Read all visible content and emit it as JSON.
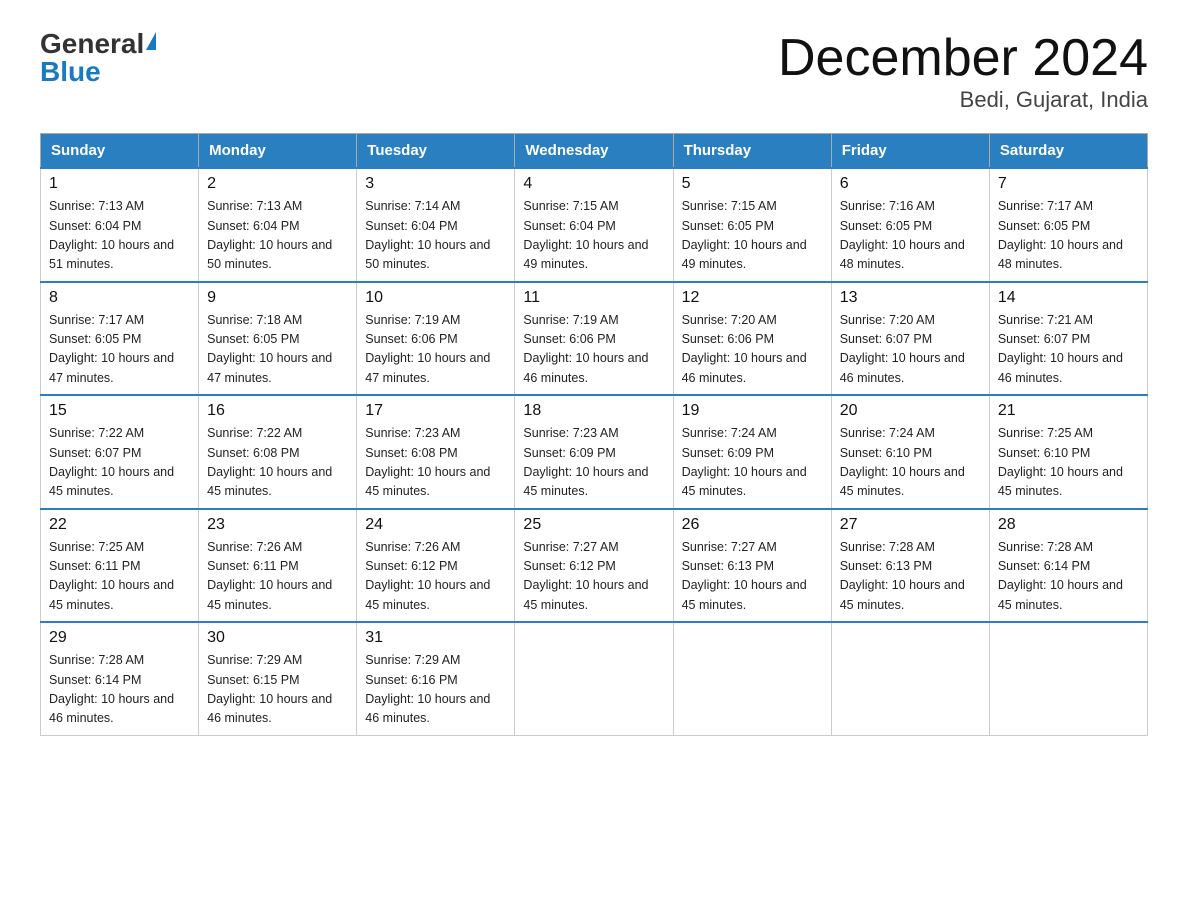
{
  "logo": {
    "general": "General",
    "blue": "Blue"
  },
  "title": {
    "month_year": "December 2024",
    "location": "Bedi, Gujarat, India"
  },
  "header_days": [
    "Sunday",
    "Monday",
    "Tuesday",
    "Wednesday",
    "Thursday",
    "Friday",
    "Saturday"
  ],
  "weeks": [
    [
      {
        "day": "1",
        "sunrise": "7:13 AM",
        "sunset": "6:04 PM",
        "daylight": "10 hours and 51 minutes."
      },
      {
        "day": "2",
        "sunrise": "7:13 AM",
        "sunset": "6:04 PM",
        "daylight": "10 hours and 50 minutes."
      },
      {
        "day": "3",
        "sunrise": "7:14 AM",
        "sunset": "6:04 PM",
        "daylight": "10 hours and 50 minutes."
      },
      {
        "day": "4",
        "sunrise": "7:15 AM",
        "sunset": "6:04 PM",
        "daylight": "10 hours and 49 minutes."
      },
      {
        "day": "5",
        "sunrise": "7:15 AM",
        "sunset": "6:05 PM",
        "daylight": "10 hours and 49 minutes."
      },
      {
        "day": "6",
        "sunrise": "7:16 AM",
        "sunset": "6:05 PM",
        "daylight": "10 hours and 48 minutes."
      },
      {
        "day": "7",
        "sunrise": "7:17 AM",
        "sunset": "6:05 PM",
        "daylight": "10 hours and 48 minutes."
      }
    ],
    [
      {
        "day": "8",
        "sunrise": "7:17 AM",
        "sunset": "6:05 PM",
        "daylight": "10 hours and 47 minutes."
      },
      {
        "day": "9",
        "sunrise": "7:18 AM",
        "sunset": "6:05 PM",
        "daylight": "10 hours and 47 minutes."
      },
      {
        "day": "10",
        "sunrise": "7:19 AM",
        "sunset": "6:06 PM",
        "daylight": "10 hours and 47 minutes."
      },
      {
        "day": "11",
        "sunrise": "7:19 AM",
        "sunset": "6:06 PM",
        "daylight": "10 hours and 46 minutes."
      },
      {
        "day": "12",
        "sunrise": "7:20 AM",
        "sunset": "6:06 PM",
        "daylight": "10 hours and 46 minutes."
      },
      {
        "day": "13",
        "sunrise": "7:20 AM",
        "sunset": "6:07 PM",
        "daylight": "10 hours and 46 minutes."
      },
      {
        "day": "14",
        "sunrise": "7:21 AM",
        "sunset": "6:07 PM",
        "daylight": "10 hours and 46 minutes."
      }
    ],
    [
      {
        "day": "15",
        "sunrise": "7:22 AM",
        "sunset": "6:07 PM",
        "daylight": "10 hours and 45 minutes."
      },
      {
        "day": "16",
        "sunrise": "7:22 AM",
        "sunset": "6:08 PM",
        "daylight": "10 hours and 45 minutes."
      },
      {
        "day": "17",
        "sunrise": "7:23 AM",
        "sunset": "6:08 PM",
        "daylight": "10 hours and 45 minutes."
      },
      {
        "day": "18",
        "sunrise": "7:23 AM",
        "sunset": "6:09 PM",
        "daylight": "10 hours and 45 minutes."
      },
      {
        "day": "19",
        "sunrise": "7:24 AM",
        "sunset": "6:09 PM",
        "daylight": "10 hours and 45 minutes."
      },
      {
        "day": "20",
        "sunrise": "7:24 AM",
        "sunset": "6:10 PM",
        "daylight": "10 hours and 45 minutes."
      },
      {
        "day": "21",
        "sunrise": "7:25 AM",
        "sunset": "6:10 PM",
        "daylight": "10 hours and 45 minutes."
      }
    ],
    [
      {
        "day": "22",
        "sunrise": "7:25 AM",
        "sunset": "6:11 PM",
        "daylight": "10 hours and 45 minutes."
      },
      {
        "day": "23",
        "sunrise": "7:26 AM",
        "sunset": "6:11 PM",
        "daylight": "10 hours and 45 minutes."
      },
      {
        "day": "24",
        "sunrise": "7:26 AM",
        "sunset": "6:12 PM",
        "daylight": "10 hours and 45 minutes."
      },
      {
        "day": "25",
        "sunrise": "7:27 AM",
        "sunset": "6:12 PM",
        "daylight": "10 hours and 45 minutes."
      },
      {
        "day": "26",
        "sunrise": "7:27 AM",
        "sunset": "6:13 PM",
        "daylight": "10 hours and 45 minutes."
      },
      {
        "day": "27",
        "sunrise": "7:28 AM",
        "sunset": "6:13 PM",
        "daylight": "10 hours and 45 minutes."
      },
      {
        "day": "28",
        "sunrise": "7:28 AM",
        "sunset": "6:14 PM",
        "daylight": "10 hours and 45 minutes."
      }
    ],
    [
      {
        "day": "29",
        "sunrise": "7:28 AM",
        "sunset": "6:14 PM",
        "daylight": "10 hours and 46 minutes."
      },
      {
        "day": "30",
        "sunrise": "7:29 AM",
        "sunset": "6:15 PM",
        "daylight": "10 hours and 46 minutes."
      },
      {
        "day": "31",
        "sunrise": "7:29 AM",
        "sunset": "6:16 PM",
        "daylight": "10 hours and 46 minutes."
      },
      null,
      null,
      null,
      null
    ]
  ]
}
